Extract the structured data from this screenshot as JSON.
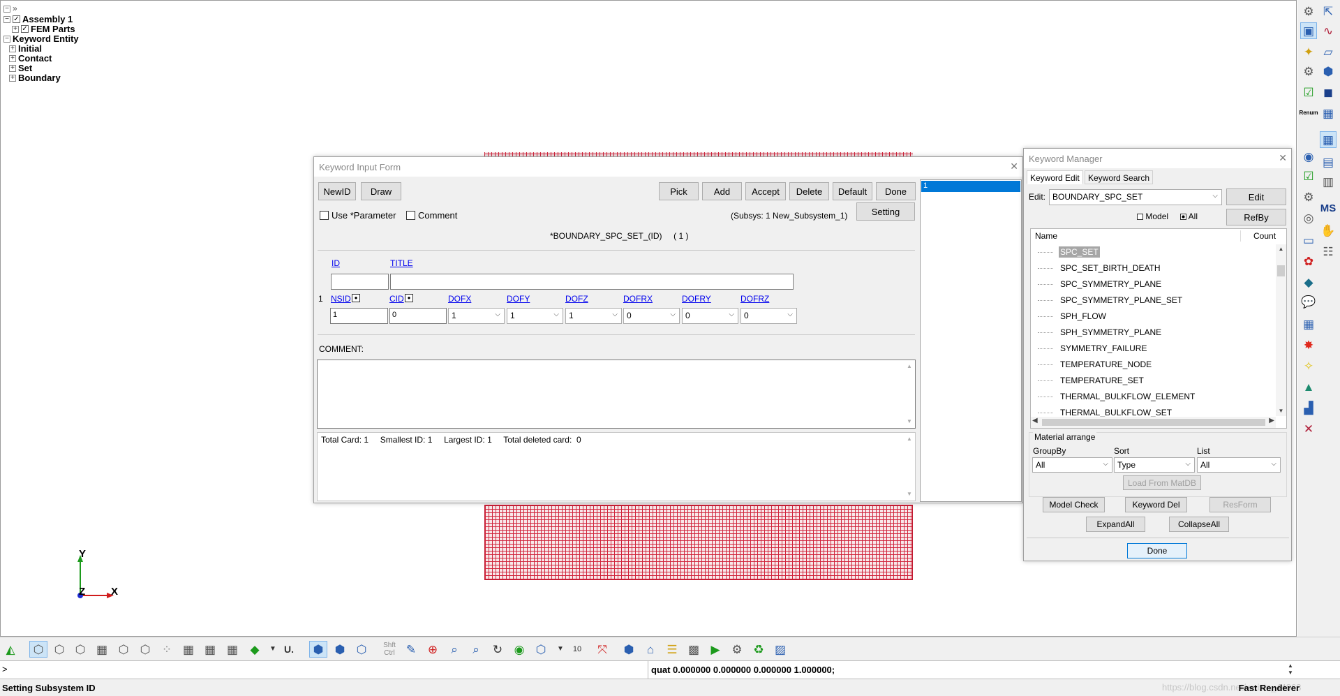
{
  "tree": {
    "assembly": "Assembly 1",
    "fem_parts": "FEM Parts",
    "keyword_entity": "Keyword Entity",
    "children": [
      "Initial",
      "Contact",
      "Set",
      "Boundary"
    ]
  },
  "triad": {
    "y": "Y",
    "z": "Z",
    "x": "X"
  },
  "kif": {
    "title": "Keyword Input Form",
    "buttons_left": [
      "NewID",
      "Draw"
    ],
    "buttons_right": [
      "Pick",
      "Add",
      "Accept",
      "Delete",
      "Default",
      "Done"
    ],
    "use_parameter": "Use *Parameter",
    "comment_cb": "Comment",
    "subsys": "(Subsys: 1 New_Subsystem_1)",
    "setting": "Setting",
    "keyword_heading": "*BOUNDARY_SPC_SET_(ID)     ( 1 )",
    "id_label": "ID",
    "title_label": "TITLE",
    "row_index": "1",
    "field_labels": [
      "NSID",
      "CID",
      "DOFX",
      "DOFY",
      "DOFZ",
      "DOFRX",
      "DOFRY",
      "DOFRZ"
    ],
    "nsid_value": "1",
    "cid_value": "0",
    "dof_values": [
      "1",
      "1",
      "1",
      "0",
      "0",
      "0"
    ],
    "comment_label": "COMMENT:",
    "summary": "Total Card: 1     Smallest ID: 1     Largest ID: 1     Total deleted card:  0",
    "id_list": [
      "1"
    ]
  },
  "km": {
    "title": "Keyword Manager",
    "tabs": [
      "Keyword Edit",
      "Keyword Search"
    ],
    "edit_label": "Edit:",
    "edit_value": "BOUNDARY_SPC_SET",
    "edit_button": "Edit",
    "model_radio": "Model",
    "all_radio": "All",
    "refby": "RefBy",
    "col_name": "Name",
    "col_count": "Count",
    "items": [
      "SPC_SET",
      "SPC_SET_BIRTH_DEATH",
      "SPC_SYMMETRY_PLANE",
      "SPC_SYMMETRY_PLANE_SET",
      "SPH_FLOW",
      "SPH_SYMMETRY_PLANE",
      "SYMMETRY_FAILURE",
      "TEMPERATURE_NODE",
      "TEMPERATURE_SET",
      "THERMAL_BULKFLOW_ELEMENT",
      "THERMAL_BULKFLOW_SET"
    ],
    "material_arrange": "Material arrange",
    "groupby_label": "GroupBy",
    "sort_label": "Sort",
    "list_label": "List",
    "groupby_value": "All",
    "sort_value": "Type",
    "list_value": "All",
    "load_matdb": "Load From MatDB",
    "model_check": "Model Check",
    "keyword_del": "Keyword Del",
    "resform": "ResForm",
    "expand_all": "ExpandAll",
    "collapse_all": "CollapseAll",
    "done": "Done"
  },
  "toolbar": {
    "shft": "Shft",
    "ctrl": "Ctrl",
    "ten": "10",
    "u_label": "U."
  },
  "cmd": {
    "prompt": ">",
    "output": "quat 0.000000 0.000000 0.000000 1.000000;"
  },
  "status": {
    "left": "Setting Subsystem ID",
    "watermark": "https://blog.csdn.net/weixin_44863",
    "right": "Fast Renderer"
  },
  "right_toolbar": {
    "reman": "Renum",
    "ms": "MS"
  },
  "colors": {
    "mesh": "#d0243b",
    "accent": "#0078d7",
    "selection": "#0078d7"
  }
}
